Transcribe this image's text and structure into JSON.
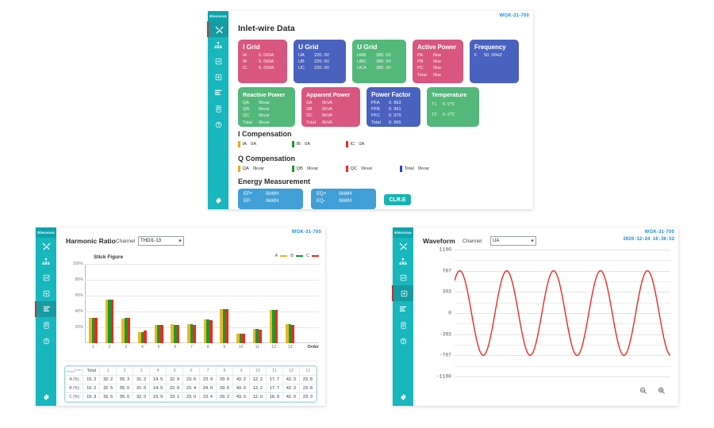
{
  "brand": "WGK-31-700",
  "logo": "Elecnova",
  "dashboard": {
    "title": "Inlet-wire Data",
    "active_icon_index": 0,
    "cards": [
      {
        "title": "I Grid",
        "color": "pink",
        "rows": [
          [
            "IA",
            "5. 000A"
          ],
          [
            "IB",
            "5. 000A"
          ],
          [
            "IC",
            "5. 000A"
          ]
        ]
      },
      {
        "title": "U Grid",
        "color": "blue",
        "rows": [
          [
            "UA",
            "220. 0V"
          ],
          [
            "UB",
            "220. 0V"
          ],
          [
            "UC",
            "220. 0V"
          ]
        ]
      },
      {
        "title": "U Grid",
        "color": "green",
        "rows": [
          [
            "UAB",
            "380. 0V"
          ],
          [
            "UBC",
            "380. 0V"
          ],
          [
            "UCA",
            "380. 0V"
          ]
        ]
      },
      {
        "title": "Active Power",
        "color": "pink",
        "rows": [
          [
            "PA",
            "0kw"
          ],
          [
            "PB",
            "0kw"
          ],
          [
            "PC",
            "0kw"
          ],
          [
            "Total",
            "0kw"
          ]
        ]
      },
      {
        "title": "Frequency",
        "color": "blue",
        "rows": [
          [
            "F",
            "50. 00HZ"
          ]
        ]
      },
      {
        "title": "Reactive Power",
        "color": "green",
        "rows": [
          [
            "QA",
            "0kvar"
          ],
          [
            "QB",
            "0kvar"
          ],
          [
            "QC",
            "0kvar"
          ],
          [
            "Total",
            "0kvar"
          ]
        ]
      },
      {
        "title": "Apparent Power",
        "color": "pink",
        "rows": [
          [
            "SA",
            "0kVA"
          ],
          [
            "SB",
            "0kVA"
          ],
          [
            "SC",
            "0kVA"
          ],
          [
            "Total",
            "0kVA"
          ]
        ]
      },
      {
        "title": "Power Factor",
        "color": "blue",
        "rows": [
          [
            "PFA",
            "0. 963"
          ],
          [
            "PFB",
            "0. 961"
          ],
          [
            "PFC",
            "0. 970"
          ],
          [
            "Total",
            "0. 965"
          ]
        ]
      },
      {
        "title": "Temperature",
        "color": "green",
        "rows": [
          [
            "T1",
            "0. 0℃"
          ],
          [
            "T2",
            "0. 0℃"
          ]
        ]
      }
    ],
    "i_compensation": {
      "title": "I Compensation",
      "items": [
        {
          "name": "IA",
          "value": "0A",
          "color": "#f0a81e"
        },
        {
          "name": "IB",
          "value": "0A",
          "color": "#1a9a2e"
        },
        {
          "name": "IC",
          "value": "0A",
          "color": "#ee2a22"
        }
      ]
    },
    "q_compensation": {
      "title": "Q Compensation",
      "items": [
        {
          "name": "QA",
          "value": "0kvar",
          "color": "#f0a81e"
        },
        {
          "name": "QB",
          "value": "0kvar",
          "color": "#1a9a2e"
        },
        {
          "name": "QC",
          "value": "0kvar",
          "color": "#ee2a22"
        },
        {
          "name": "Total",
          "value": "0kvar",
          "color": "#2a43d8"
        }
      ]
    },
    "energy": {
      "title": "Energy Measurement",
      "box1": [
        [
          "EP+",
          "0kWH"
        ],
        [
          "EP-",
          "0kWH"
        ]
      ],
      "box2": [
        [
          "EQ+",
          "0kWH"
        ],
        [
          "EQ-",
          "0kWH"
        ]
      ],
      "clear_label": "CLR.E"
    }
  },
  "harmonic": {
    "title": "Harmonic Ratio",
    "channel_label": "Channel",
    "channel_value": "THDI1-13",
    "stick_figure_label": "Stick Figure",
    "active_icon_index": 4,
    "legend": [
      {
        "name": "A",
        "color": "#e8b828"
      },
      {
        "name": "B",
        "color": "#1a9a2e"
      },
      {
        "name": "C",
        "color": "#ee2a22"
      }
    ],
    "chart_data": {
      "type": "bar",
      "title": "Harmonic Ratio",
      "xlabel": "Order",
      "ylabel": "",
      "ylim": [
        0,
        100
      ],
      "ytick_labels": [
        "100%",
        "80%",
        "60%",
        "40%",
        "20%"
      ],
      "yticks": [
        100,
        80,
        60,
        40,
        20
      ],
      "grid": true,
      "legend_position": "top-right",
      "categories": [
        "1",
        "2",
        "3",
        "4",
        "5",
        "6",
        "7",
        "8",
        "9",
        "10",
        "11",
        "12",
        "13"
      ],
      "series": [
        {
          "name": "A",
          "color": "#e8b828",
          "values": [
            32.2,
            55.3,
            31.2,
            14.5,
            22.9,
            23.6,
            23.9,
            29.6,
            43.2,
            12.2,
            17.7,
            42.3,
            23.8
          ]
        },
        {
          "name": "B",
          "color": "#1a9a2e",
          "values": [
            32.5,
            55.0,
            31.6,
            14.5,
            22.9,
            23.4,
            24.0,
            29.6,
            43.0,
            12.2,
            17.7,
            42.3,
            23.8
          ]
        },
        {
          "name": "C",
          "color": "#ee2a22",
          "values": [
            32.5,
            55.0,
            32.0,
            15.9,
            23.1,
            23.0,
            23.4,
            29.2,
            43.0,
            12.0,
            16.9,
            42.0,
            23.3
          ]
        }
      ]
    },
    "table": {
      "corner_row_label": "Phase",
      "corner_col_label": "Order",
      "headers": [
        "Total",
        "1",
        "2",
        "3",
        "4",
        "5",
        "6",
        "7",
        "8",
        "9",
        "10",
        "11",
        "12",
        "13"
      ],
      "rows": [
        {
          "label": "A (%)",
          "values": [
            "15. 2",
            "32. 2",
            "55. 3",
            "31. 2",
            "14. 5",
            "22. 9",
            "23. 6",
            "23. 9",
            "29. 6",
            "43. 2",
            "12. 2",
            "17. 7",
            "42. 3",
            "23. 8"
          ]
        },
        {
          "label": "B (%)",
          "values": [
            "15. 2",
            "32. 5",
            "55. 0",
            "31. 6",
            "14. 5",
            "22. 9",
            "23. 4",
            "24. 0",
            "29. 6",
            "43. 0",
            "12. 2",
            "17. 7",
            "42. 3",
            "23. 8"
          ]
        },
        {
          "label": "C (%)",
          "values": [
            "15. 3",
            "32. 5",
            "55. 0",
            "32. 0",
            "15. 9",
            "23. 1",
            "23. 0",
            "23. 4",
            "29. 2",
            "43. 0",
            "12. 0",
            "16. 9",
            "42. 0",
            "23. 3"
          ]
        }
      ]
    }
  },
  "waveform": {
    "title": "Waveform",
    "channel_label": "Channel",
    "channel_value": "UA",
    "timestamp": "2020-12-24  16:36:52",
    "active_icon_index": 3,
    "zoom_out_label": "zoom-out",
    "zoom_in_label": "zoom-in",
    "chart_data": {
      "type": "line",
      "title": "Waveform",
      "xlabel": "",
      "ylabel": "",
      "ylim": [
        -1180,
        1180
      ],
      "ytick_labels": [
        "1180",
        "787",
        "393",
        "0",
        "-393",
        "-787",
        "-1180"
      ],
      "yticks": [
        1180,
        787,
        393,
        0,
        -393,
        -787,
        -1180
      ],
      "grid": true,
      "series": [
        {
          "name": "UA",
          "color": "#ee2a22",
          "waveform": "sine",
          "amplitude": 787,
          "cycles": 4.6,
          "phase_deg": 50
        }
      ]
    }
  }
}
